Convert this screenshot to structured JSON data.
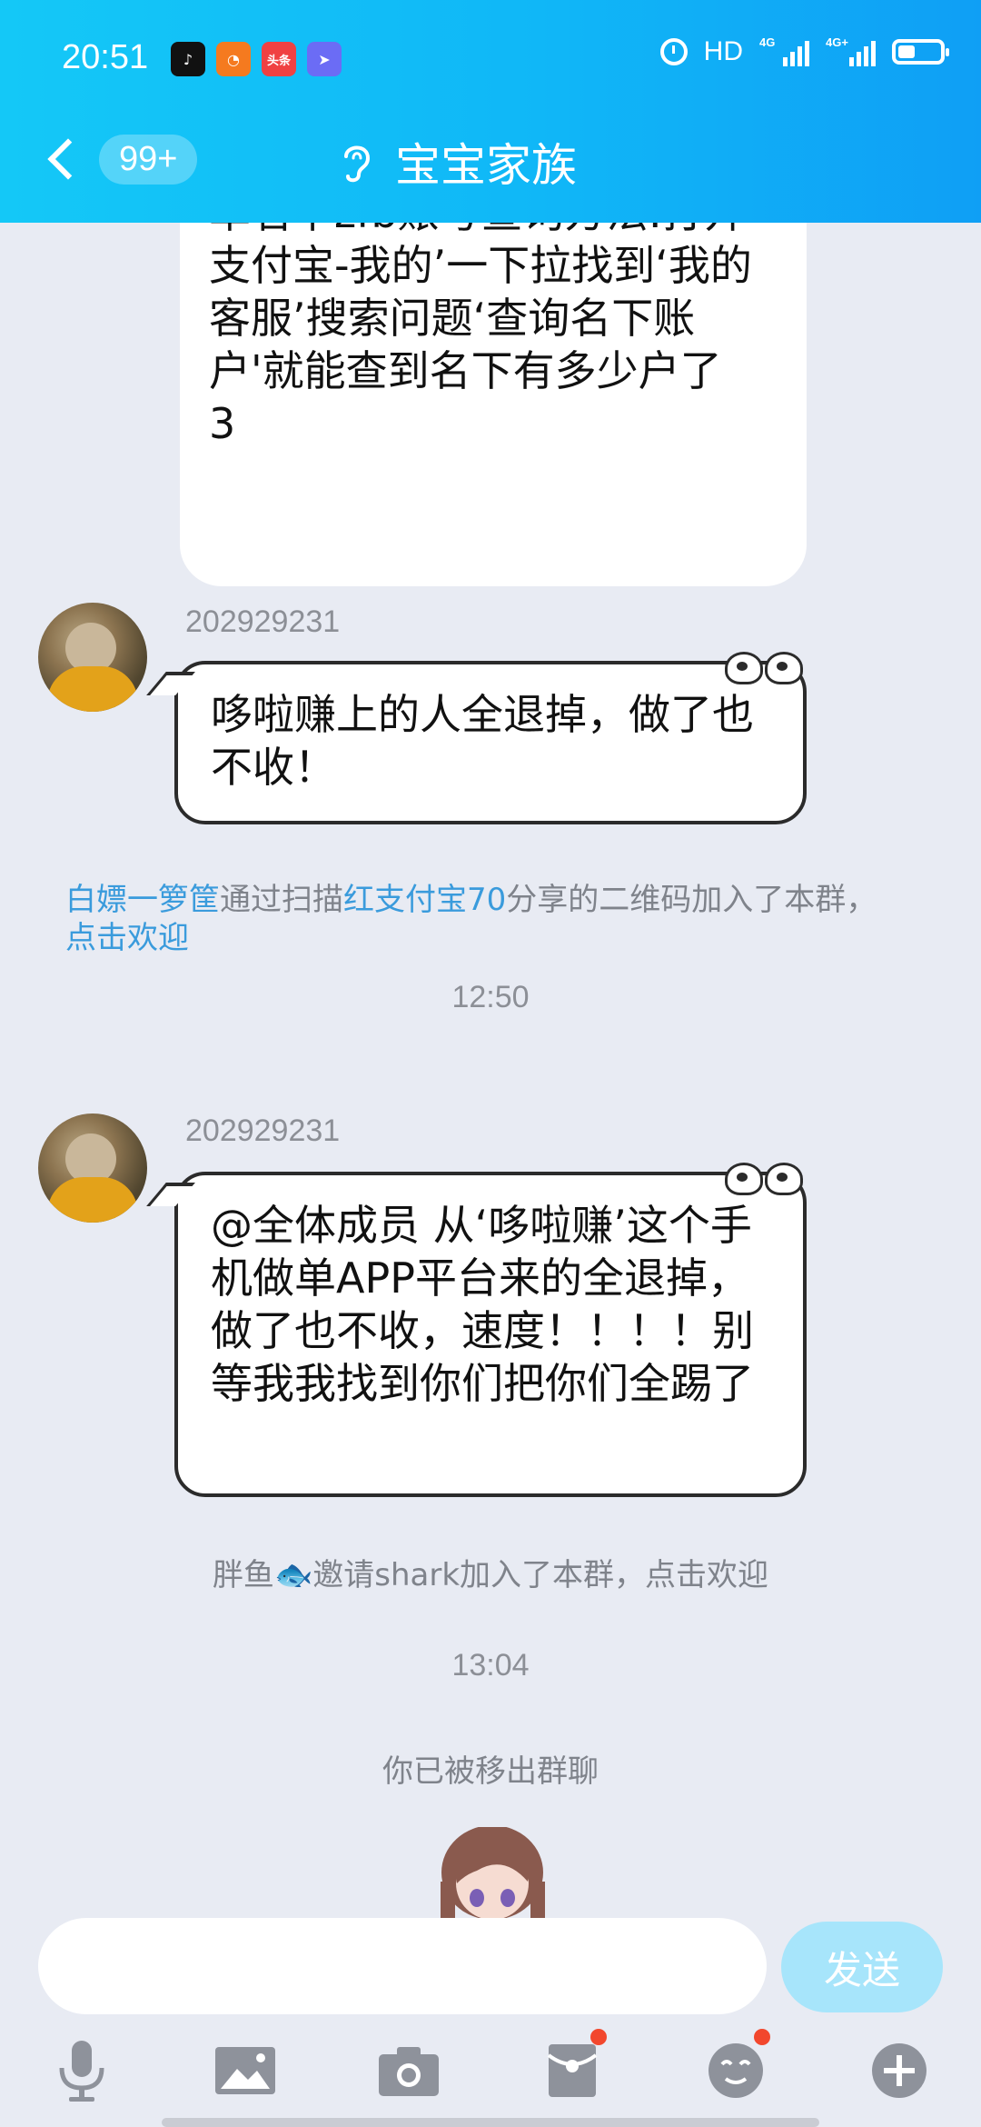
{
  "status_bar": {
    "time": "20:51",
    "hd_label": "HD",
    "network_1": "4G",
    "network_2": "4G+",
    "toutiao_label": "头条",
    "icons": [
      "douyin-icon",
      "uc-browser-icon",
      "toutiao-icon",
      "feishu-icon",
      "alarm-icon",
      "signal-icon",
      "battery-icon"
    ]
  },
  "nav": {
    "unread_count": "99+",
    "group_title": "宝宝家族",
    "icons": [
      "back-chevron-icon",
      "ear-icon"
    ]
  },
  "messages": {
    "partial_message_text": "单名下zfb账号查询方法:打开支付宝-我的’一下拉找到‘我的客服’搜索问题‘查询名下账户'就能查到名下有多少户了\n3",
    "msg1": {
      "sender": "202929231",
      "text": "哆啦赚上的人全退掉，做了也不收！"
    },
    "join_notice": {
      "user": "白嫖一箩筐",
      "action_1": "通过扫描",
      "inviter": "红支付宝70",
      "action_2": "分享的二维码加入了本群，",
      "welcome_link": "点击欢迎"
    },
    "time_1": "12:50",
    "msg2": {
      "sender": "202929231",
      "text": "@全体成员 从‘哆啦赚’这个手机做单APP平台来的全退掉，做了也不收，速度！！！！别等我我找到你们把你们全踢了"
    },
    "invite_notice": {
      "inviter": "胖鱼",
      "action_1": "邀请",
      "invitee": "shark",
      "action_2": "加入了本群，",
      "welcome_link": "点击欢迎"
    },
    "time_2": "13:04",
    "removed_notice": "你已被移出群聊"
  },
  "input": {
    "value": "",
    "send_label": "发送"
  },
  "toolbar": {
    "items": [
      "microphone-icon",
      "image-icon",
      "camera-icon",
      "red-packet-icon",
      "emoji-icon",
      "plus-icon"
    ]
  },
  "colors": {
    "header_gradient_start": "#14c8f7",
    "header_gradient_end": "#0f9ff5",
    "background": "#e8ebf3",
    "link": "#3a9bdc",
    "send_button": "#a7e5fb",
    "notification_dot": "#f2472d"
  }
}
